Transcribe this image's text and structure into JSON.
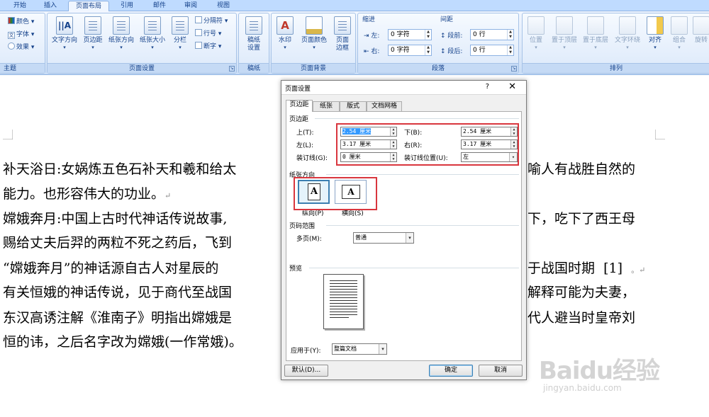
{
  "tabs": [
    {
      "label": "开始"
    },
    {
      "label": "插入"
    },
    {
      "label": "页面布局",
      "active": true
    },
    {
      "label": "引用"
    },
    {
      "label": "邮件"
    },
    {
      "label": "审阅"
    },
    {
      "label": "视图"
    }
  ],
  "ribbon": {
    "theme": {
      "label": "主题",
      "colors": "颜色",
      "fonts": "字体",
      "effects": "效果"
    },
    "page_setup": {
      "label": "页面设置",
      "text_direction": "文字方向",
      "margins": "页边距",
      "orientation": "纸张方向",
      "size": "纸张大小",
      "columns": "分栏",
      "breaks": "分隔符",
      "line_numbers": "行号",
      "hyphenation": "断字"
    },
    "manuscript": {
      "label": "稿纸",
      "setup_line1": "稿纸",
      "setup_line2": "设置"
    },
    "page_background": {
      "label": "页面背景",
      "watermark": "水印",
      "page_color": "页面颜色",
      "borders_line1": "页面",
      "borders_line2": "边框"
    },
    "paragraph": {
      "label": "段落",
      "indent": "缩进",
      "spacing": "间距",
      "indent_left_label": "左:",
      "indent_left_value": "0 字符",
      "indent_right_label": "右:",
      "indent_right_value": "0 字符",
      "space_before_label": "段前:",
      "space_before_value": "0 行",
      "space_after_label": "段后:",
      "space_after_value": "0 行"
    },
    "arrange": {
      "label": "排列",
      "position": "位置",
      "bring_front": "置于顶层",
      "send_back": "置于底层",
      "wrap": "文字环绕",
      "align": "对齐",
      "group": "组合",
      "rotate": "旋转"
    }
  },
  "document": {
    "lines": [
      "补天浴日:女娲炼五色石补天和羲和给太",
      "能力。也形容伟大的功业。",
      "嫦娥奔月:中国上古时代神话传说故事,",
      "赐给丈夫后羿的两粒不死之药后，飞到",
      "“嫦娥奔月”的神话源自古人对星辰的",
      "有关恒娥的神话传说，见于商代至战国",
      "东汉高诱注解《淮南子》明指出嫦娥是",
      "恒的讳，之后名字改为嫦娥(一作常娥)。"
    ],
    "right_fragments": [
      "喻人有战胜自然的",
      "下，吃下了西王母",
      "于战国时期",
      "[1]",
      "解释可能为夫妻，",
      "代人避当时皇帝刘",
      "恒的讳"
    ]
  },
  "dialog": {
    "title": "页面设置",
    "help": "?",
    "close": "✕",
    "tabs": [
      {
        "label": "页边距",
        "active": true
      },
      {
        "label": "纸张"
      },
      {
        "label": "版式"
      },
      {
        "label": "文档网格"
      }
    ],
    "margins_section": "页边距",
    "top_label": "上(T):",
    "top_value": "2.54 厘米",
    "bottom_label": "下(B):",
    "bottom_value": "2.54 厘米",
    "left_label": "左(L):",
    "left_value": "3.17 厘米",
    "right_label": "右(R):",
    "right_value": "3.17 厘米",
    "gutter_label": "装订线(G):",
    "gutter_value": "0 厘米",
    "gutter_pos_label": "装订线位置(U):",
    "gutter_pos_value": "左",
    "orientation_section": "纸张方向",
    "portrait_label": "纵向(P)",
    "landscape_label": "横向(S)",
    "orientation_glyph": "A",
    "pages_section": "页码范围",
    "multiple_pages_label": "多页(M):",
    "multiple_pages_value": "普通",
    "preview_section": "预览",
    "apply_label": "应用于(Y):",
    "apply_value": "整篇文档",
    "default_button": "默认(D)...",
    "ok_button": "确定",
    "cancel_button": "取消"
  },
  "watermark": {
    "logo": "Baidu经验",
    "url": "jingyan.baidu.com"
  },
  "colors": {
    "highlight": "#d9363e",
    "ribbon": "#dbe8f9",
    "selection": "#3399ff"
  }
}
